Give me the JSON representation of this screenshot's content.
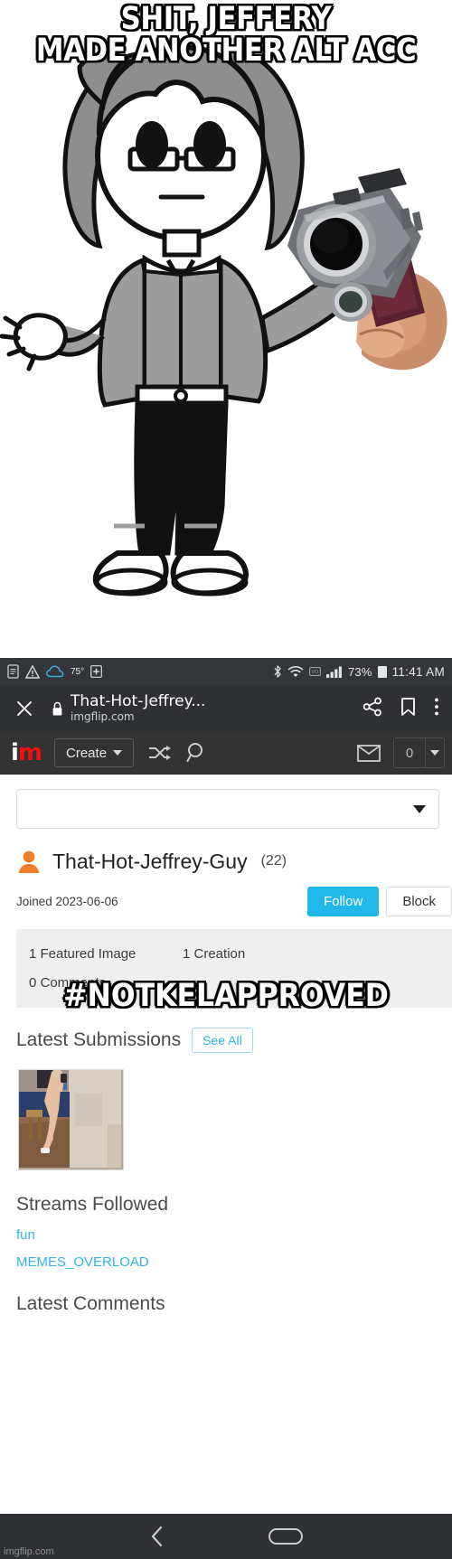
{
  "meme": {
    "top_caption": "SHIT, JEFFERY\nMADE ANOTHER ALT ACC",
    "mid_caption": "#NOTKELAPPROVED",
    "watermark": "imgflip.com"
  },
  "statusbar": {
    "temperature": "75°",
    "battery_percent": "73%",
    "time": "11:41 AM",
    "icons_left": [
      "note-icon",
      "warning-triangle-icon",
      "cloud-icon",
      "plus-icon"
    ],
    "icons_right": [
      "bluetooth-icon",
      "wifi-icon",
      "sim-icon",
      "signal-bars-icon",
      "battery-icon"
    ]
  },
  "browserbar": {
    "close_label": "✕",
    "lock_icon": "lock-icon",
    "title": "That-Hot-Jeffrey...",
    "host": "imgflip.com",
    "share_icon": "share-icon",
    "bookmark_icon": "bookmark-icon",
    "overflow_icon": "three-dot-menu-icon"
  },
  "siteheader": {
    "logo_i": "i",
    "logo_m": "m",
    "create_label": "Create",
    "shuffle_icon": "shuffle-icon",
    "search_icon": "search-icon",
    "mail_icon": "envelope-icon",
    "notification_count": "0",
    "accent_red": "#f40f0f"
  },
  "search": {
    "value": "",
    "placeholder": ""
  },
  "profile": {
    "avatar_icon": "user-avatar-icon",
    "username": "That-Hot-Jeffrey-Guy",
    "points": "(22)",
    "joined": "Joined 2023-06-06",
    "follow_label": "Follow",
    "block_label": "Block",
    "follow_color": "#21b7e8",
    "stats": {
      "featured": "1 Featured Image",
      "creations": "1 Creation",
      "comments": "0 Comments"
    }
  },
  "latest_submissions": {
    "title": "Latest Submissions",
    "see_all_label": "See All",
    "thumbnail_alt": "submission-thumbnail"
  },
  "streams_followed": {
    "title": "Streams Followed",
    "items": [
      {
        "label": "fun"
      },
      {
        "label": "MEMES_OVERLOAD"
      }
    ],
    "link_color": "#31b6e3"
  },
  "latest_comments": {
    "title": "Latest Comments"
  },
  "navbar": {
    "back_icon": "back-chevron-icon",
    "home_icon": "home-pill-icon"
  }
}
